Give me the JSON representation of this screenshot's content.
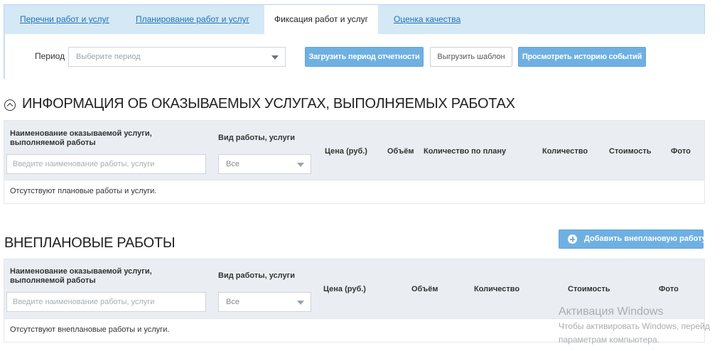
{
  "tabs": [
    {
      "label": "Перечни работ и услуг",
      "active": false
    },
    {
      "label": "Планирование работ и услуг",
      "active": false
    },
    {
      "label": "Фиксация работ и услуг",
      "active": true
    },
    {
      "label": "Оценка качества",
      "active": false
    }
  ],
  "toolbar": {
    "period_label": "Период",
    "period_placeholder": "Выберите период",
    "load_period_button": "Загрузить период отчетности",
    "export_template_button": "Выгрузить шаблон",
    "history_button": "Просмотреть историю событий"
  },
  "planned_section": {
    "title": "ИНФОРМАЦИЯ ОБ ОКАЗЫВАЕМЫХ УСЛУГАХ, ВЫПОЛНЯЕМЫХ РАБОТАХ",
    "columns": {
      "name": "Наименование оказываемой услуги, выполняемой работы",
      "type": "Вид работы, услуги",
      "price": "Цена (руб.)",
      "volume": "Объём",
      "planned_qty": "Количество по плану",
      "qty": "Количество",
      "cost": "Стоимость",
      "photo": "Фото"
    },
    "name_placeholder": "Введите наименование работы, услуги",
    "type_value": "Все",
    "empty_message": "Отсутствуют плановые работы и услуги."
  },
  "unplanned_section": {
    "title": "ВНЕПЛАНОВЫЕ РАБОТЫ",
    "add_button": "Добавить внеплановую работу",
    "columns": {
      "name": "Наименование оказываемой услуги, выполняемой работы",
      "type": "Вид работы, услуги",
      "price": "Цена (руб.)",
      "volume": "Объём",
      "qty": "Количество",
      "cost": "Стоимость",
      "photo": "Фото"
    },
    "name_placeholder": "Введите наименование работы, услуги",
    "type_value": "Все",
    "empty_message": "Отсутствуют внеплановые работы и услуги."
  },
  "watermark": {
    "title": "Активация Windows",
    "line1": "Чтобы активировать Windows, перейд",
    "line2": "параметрам компьютера."
  }
}
